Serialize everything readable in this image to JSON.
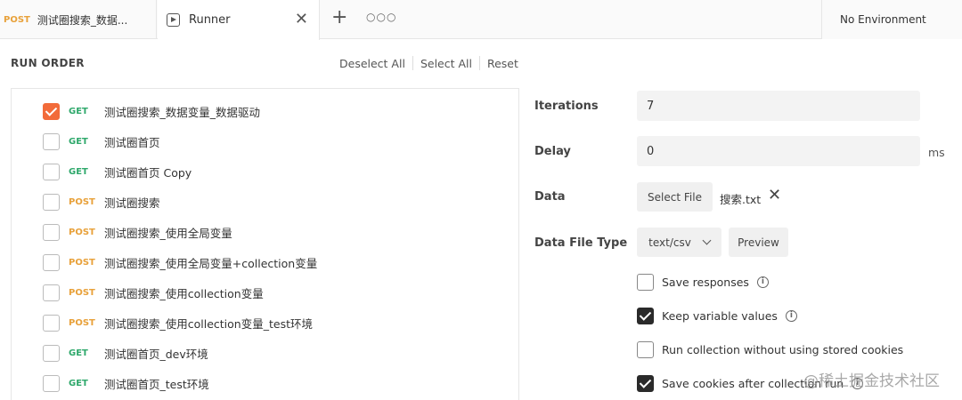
{
  "tabs": {
    "first": {
      "method": "POST",
      "title": "测试圈搜索_数据..."
    },
    "active": {
      "title": "Runner"
    },
    "environment": "No Environment"
  },
  "run_order": {
    "title": "RUN ORDER",
    "deselect_all": "Deselect All",
    "select_all": "Select All",
    "reset": "Reset"
  },
  "requests": [
    {
      "checked": true,
      "method": "GET",
      "name": "测试圈搜索_数据变量_数据驱动"
    },
    {
      "checked": false,
      "method": "GET",
      "name": "测试圈首页"
    },
    {
      "checked": false,
      "method": "GET",
      "name": "测试圈首页 Copy"
    },
    {
      "checked": false,
      "method": "POST",
      "name": "测试圈搜索"
    },
    {
      "checked": false,
      "method": "POST",
      "name": "测试圈搜索_使用全局变量"
    },
    {
      "checked": false,
      "method": "POST",
      "name": "测试圈搜索_使用全局变量+collection变量"
    },
    {
      "checked": false,
      "method": "POST",
      "name": "测试圈搜索_使用collection变量"
    },
    {
      "checked": false,
      "method": "POST",
      "name": "测试圈搜索_使用collection变量_test环境"
    },
    {
      "checked": false,
      "method": "GET",
      "name": "测试圈首页_dev环境"
    },
    {
      "checked": false,
      "method": "GET",
      "name": "测试圈首页_test环境"
    }
  ],
  "settings": {
    "iterations_label": "Iterations",
    "iterations_value": "7",
    "delay_label": "Delay",
    "delay_value": "0",
    "delay_unit": "ms",
    "data_label": "Data",
    "select_file": "Select File",
    "file_name": "搜索.txt",
    "data_file_type_label": "Data File Type",
    "data_file_type_value": "text/csv",
    "preview": "Preview",
    "options": [
      {
        "label": "Save responses",
        "checked": false,
        "info": true
      },
      {
        "label": "Keep variable values",
        "checked": true,
        "info": true
      },
      {
        "label": "Run collection without using stored cookies",
        "checked": false,
        "info": false
      },
      {
        "label": "Save cookies after collection run",
        "checked": true,
        "info": true
      }
    ]
  },
  "watermark": "@稀土掘金技术社区",
  "colors": {
    "get": "#2ea86b",
    "post": "#e8a13a",
    "accent": "#f26b3a"
  }
}
